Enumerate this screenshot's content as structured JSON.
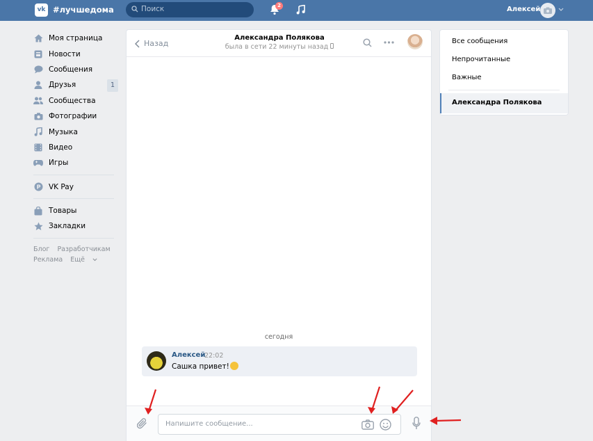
{
  "header": {
    "logo_text": "vk",
    "hashtag": "#лучшедома",
    "search_placeholder": "Поиск",
    "notifications_count": "2",
    "user_name": "Алексей"
  },
  "sidebar": {
    "items": [
      {
        "label": "Моя страница",
        "icon": "home-icon"
      },
      {
        "label": "Новости",
        "icon": "news-icon"
      },
      {
        "label": "Сообщения",
        "icon": "messages-icon"
      },
      {
        "label": "Друзья",
        "icon": "friends-icon",
        "badge": "1"
      },
      {
        "label": "Сообщества",
        "icon": "communities-icon"
      },
      {
        "label": "Фотографии",
        "icon": "camera-icon"
      },
      {
        "label": "Музыка",
        "icon": "music-icon"
      },
      {
        "label": "Видео",
        "icon": "video-icon"
      },
      {
        "label": "Игры",
        "icon": "games-icon"
      }
    ],
    "vkpay": "VK Pay",
    "goods": "Товары",
    "bookmarks": "Закладки",
    "footer": {
      "blog": "Блог",
      "developers": "Разработчикам",
      "ads": "Реклама",
      "more": "Ещё"
    }
  },
  "chat": {
    "back_label": "Назад",
    "peer_name": "Александра Полякова",
    "peer_status": "была в сети 22 минуты назад",
    "date_separator": "сегодня",
    "message": {
      "author": "Алексей",
      "time": "22:02",
      "text": "Сашка привет!"
    },
    "composer_placeholder": "Напишите сообщение..."
  },
  "right_panel": {
    "all_messages": "Все сообщения",
    "unread": "Непрочитанные",
    "important": "Важные",
    "active_conversation": "Александра Полякова"
  },
  "colors": {
    "header_bg": "#4a76a8",
    "accent": "#5181b8",
    "annotation_arrow": "#e02020"
  }
}
